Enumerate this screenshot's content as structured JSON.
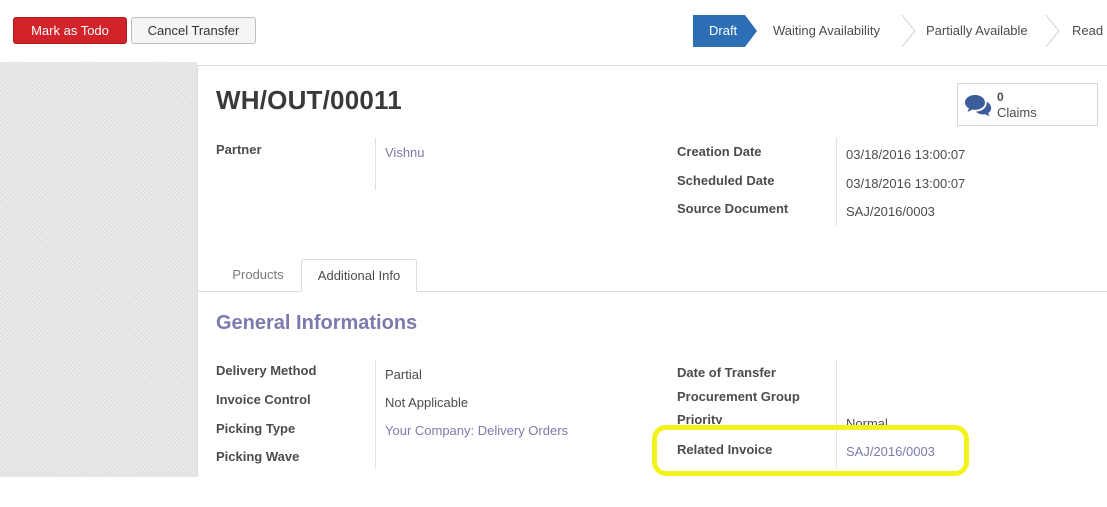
{
  "toolbar": {
    "mark_as_todo_label": "Mark as Todo",
    "cancel_transfer_label": "Cancel Transfer"
  },
  "statusbar": {
    "stages": [
      "Draft",
      "Waiting Availability",
      "Partially Available",
      "Read"
    ],
    "active_stage": "Draft"
  },
  "record": {
    "title": "WH/OUT/00011"
  },
  "smart_button": {
    "count": "0",
    "label": "Claims",
    "icon": "comments-icon"
  },
  "header_fields": {
    "partner_label": "Partner",
    "partner_value": "Vishnu",
    "creation_date_label": "Creation Date",
    "creation_date_value": "03/18/2016 13:00:07",
    "scheduled_date_label": "Scheduled Date",
    "scheduled_date_value": "03/18/2016 13:00:07",
    "source_document_label": "Source Document",
    "source_document_value": "SAJ/2016/0003"
  },
  "tabs": [
    {
      "label": "Products",
      "active": false
    },
    {
      "label": "Additional Info",
      "active": true
    }
  ],
  "section": {
    "title": "General Informations"
  },
  "info_fields": {
    "delivery_method_label": "Delivery Method",
    "delivery_method_value": "Partial",
    "invoice_control_label": "Invoice Control",
    "invoice_control_value": "Not Applicable",
    "picking_type_label": "Picking Type",
    "picking_type_value": "Your Company: Delivery Orders",
    "picking_wave_label": "Picking Wave",
    "date_of_transfer_label": "Date of Transfer",
    "procurement_group_label": "Procurement Group",
    "priority_label": "Priority",
    "priority_value": "Normal",
    "related_invoice_label": "Related Invoice",
    "related_invoice_value": "SAJ/2016/0003"
  },
  "colors": {
    "primary_button": "#d2232a",
    "active_stage": "#2c6fb7",
    "link": "#7c7bad",
    "highlight": "#f2f21c"
  }
}
